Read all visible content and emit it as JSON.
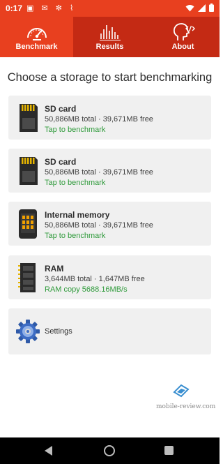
{
  "status_bar": {
    "time": "0:17",
    "left_icons": "▣ ✉ ✼ ⌇",
    "battery": "▮"
  },
  "tabs": [
    {
      "label": "Benchmark",
      "icon": "speedometer-icon",
      "active": true
    },
    {
      "label": "Results",
      "icon": "bar-chart-icon",
      "active": false
    },
    {
      "label": "About",
      "icon": "head-code-icon",
      "active": false
    }
  ],
  "page_title": "Choose a storage to start benchmarking",
  "storages": [
    {
      "title": "SD card",
      "details": "50,886MB total · 39,671MB free",
      "action": "Tap to benchmark",
      "icon": "sd-card-icon"
    },
    {
      "title": "SD card",
      "details": "50,886MB total · 39,671MB free",
      "action": "Tap to benchmark",
      "icon": "sd-card-icon"
    },
    {
      "title": "Internal memory",
      "details": "50,886MB total · 39,671MB free",
      "action": "Tap to benchmark",
      "icon": "phone-memory-icon"
    },
    {
      "title": "RAM",
      "details": "3,644MB total · 1,647MB free",
      "action": "RAM copy 5688.16MB/s",
      "icon": "ram-chip-icon"
    }
  ],
  "settings": {
    "label": "Settings",
    "icon": "gear-icon"
  },
  "watermark": "mobile-review.com",
  "colors": {
    "accent": "#e8401f",
    "accent_dark": "#c42a14",
    "action_green": "#2e9a3a",
    "card_bg": "#f0f0f0"
  }
}
